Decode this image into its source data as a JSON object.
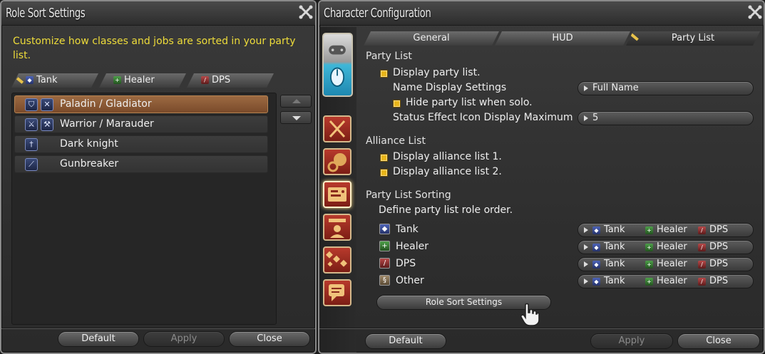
{
  "role_sort_window": {
    "title": "Role Sort Settings",
    "description": "Customize how classes and jobs are sorted in your party list.",
    "role_tabs": [
      "Tank",
      "Healer",
      "DPS"
    ],
    "jobs": [
      {
        "label": "Paladin / Gladiator",
        "selected": true,
        "icons": [
          "paladin-icon",
          "gladiator-icon"
        ]
      },
      {
        "label": "Warrior / Marauder",
        "selected": false,
        "icons": [
          "warrior-icon",
          "marauder-icon"
        ]
      },
      {
        "label": "Dark knight",
        "selected": false,
        "icons": [
          "dark-knight-icon"
        ]
      },
      {
        "label": "Gunbreaker",
        "selected": false,
        "icons": [
          "gunbreaker-icon"
        ]
      }
    ],
    "buttons": {
      "default": "Default",
      "apply": "Apply",
      "close": "Close"
    }
  },
  "character_config_window": {
    "title": "Character Configuration",
    "tabs": [
      "General",
      "HUD",
      "Party List"
    ],
    "active_tab": "Party List",
    "party_list": {
      "heading": "Party List",
      "display_party_list": "Display party list.",
      "name_display_label": "Name Display Settings",
      "name_display_value": "Full Name",
      "hide_when_solo": "Hide party list when solo.",
      "status_effect_label": "Status Effect Icon Display Maximum",
      "status_effect_value": "5"
    },
    "alliance_list": {
      "heading": "Alliance List",
      "display_1": "Display alliance list 1.",
      "display_2": "Display alliance list 2."
    },
    "sorting": {
      "heading": "Party List Sorting",
      "description": "Define party list role order.",
      "rows": [
        {
          "role": "Tank",
          "order": [
            "Tank",
            "Healer",
            "DPS"
          ]
        },
        {
          "role": "Healer",
          "order": [
            "Tank",
            "Healer",
            "DPS"
          ]
        },
        {
          "role": "DPS",
          "order": [
            "Tank",
            "Healer",
            "DPS"
          ]
        },
        {
          "role": "Other",
          "order": [
            "Tank",
            "Healer",
            "DPS"
          ]
        }
      ],
      "role_sort_button": "Role Sort Settings"
    },
    "buttons": {
      "default": "Default",
      "apply": "Apply",
      "close": "Close"
    }
  },
  "colors": {
    "description_text": "#eedc3a",
    "checkbox": "#e8b51a",
    "selected_row": "#9c6a42",
    "side_icon": "#b83a2c"
  }
}
